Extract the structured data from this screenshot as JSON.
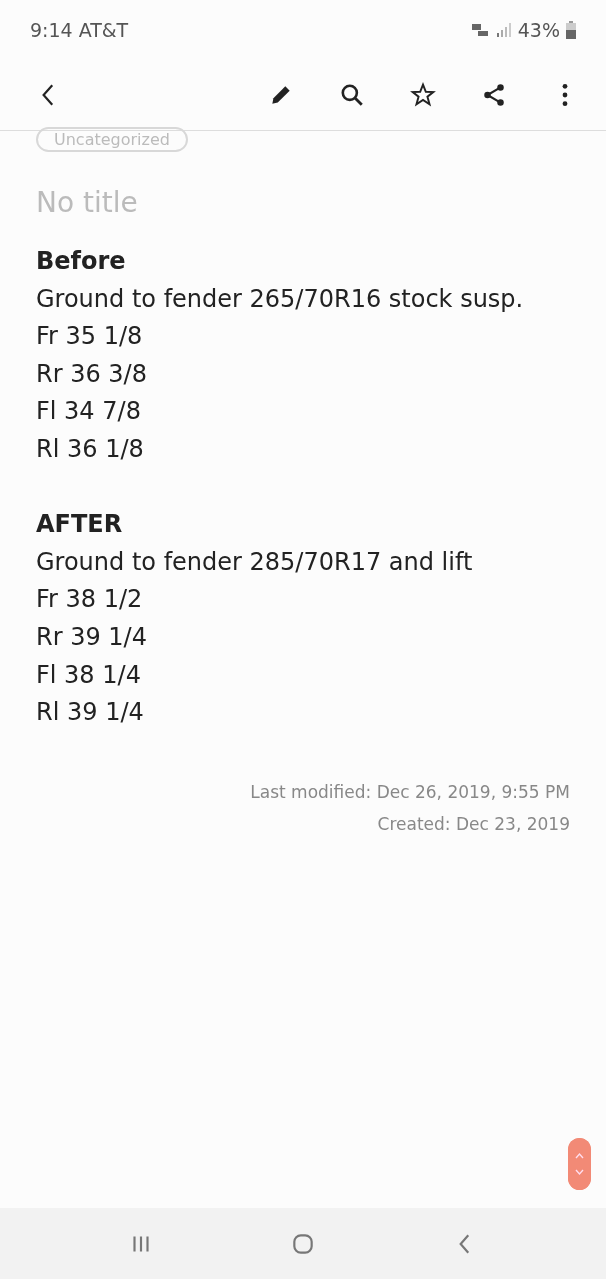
{
  "status_bar": {
    "time": "9:14",
    "carrier": "AT&T",
    "battery": "43%"
  },
  "note": {
    "category": "Uncategorized",
    "title_placeholder": "No title",
    "sections": [
      {
        "heading": "Before",
        "lines": [
          "Ground to fender 265/70R16 stock susp.",
          "Fr 35 1/8",
          "Rr 36 3/8",
          "Fl 34 7/8",
          "Rl 36 1/8"
        ]
      },
      {
        "heading": "AFTER",
        "lines": [
          "Ground to fender 285/70R17 and lift",
          "Fr 38 1/2",
          "Rr 39 1/4",
          "Fl 38 1/4",
          "Rl 39 1/4"
        ]
      }
    ],
    "last_modified": "Last modified: Dec 26, 2019, 9:55 PM",
    "created": "Created: Dec 23, 2019"
  }
}
